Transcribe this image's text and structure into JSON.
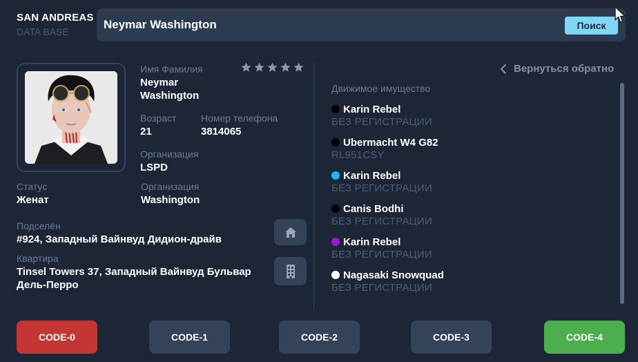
{
  "brand": {
    "title": "SAN ANDREAS",
    "subtitle": "DATA BASE"
  },
  "search": {
    "value": "Neymar Washington",
    "button_label": "Поиск"
  },
  "profile": {
    "name_label": "Имя Фамилия",
    "name_line1": "Neymar",
    "name_line2": "Washington",
    "rating": {
      "value": 0,
      "max": 5
    },
    "age_label": "Возраст",
    "age_value": "21",
    "phone_label": "Номер телефона",
    "phone_value": "3814065",
    "org_label": "Организация",
    "org_value": "LSPD",
    "status_label": "Статус",
    "status_value": "Женат",
    "org2_label": "Организация",
    "org2_value": "Washington",
    "settled_label": "Подселён",
    "settled_value": "#924, Западный Вайнвуд Дидион-драйв",
    "apartment_label": "Квартира",
    "apartment_line1": "Tinsel Towers 37, Западный Вайнвуд Бульвар",
    "apartment_line2": "Дель-Перро"
  },
  "icons": {
    "home": "home-icon",
    "building": "building-icon",
    "star": "star-icon",
    "back": "chevron-left-icon",
    "cursor": "mouse-cursor-icon"
  },
  "vehicles": {
    "header": "Движимое имущество",
    "back_label": "Вернуться обратно",
    "items": [
      {
        "name": "Karin Rebel",
        "plate": "БЕЗ РЕГИСТРАЦИИ",
        "color": "#000000"
      },
      {
        "name": "Ubermacht W4 G82",
        "plate": "RL951CSY",
        "color": "#000000"
      },
      {
        "name": "Karin Rebel",
        "plate": "БЕЗ РЕГИСТРАЦИИ",
        "color": "#1ab8f0"
      },
      {
        "name": "Canis Bodhi",
        "plate": "БЕЗ РЕГИСТРАЦИИ",
        "color": "#000000"
      },
      {
        "name": "Karin Rebel",
        "plate": "БЕЗ РЕГИСТРАЦИИ",
        "color": "#9b19d6"
      },
      {
        "name": "Nagasaki Snowquad",
        "plate": "БЕЗ РЕГИСТРАЦИИ",
        "color": "#ffffff"
      }
    ]
  },
  "codes": [
    {
      "label": "CODE-0",
      "color": "#c33634"
    },
    {
      "label": "CODE-1",
      "color": "#34435a"
    },
    {
      "label": "CODE-2",
      "color": "#34435a"
    },
    {
      "label": "CODE-3",
      "color": "#34435a"
    },
    {
      "label": "CODE-4",
      "color": "#4cae4f"
    }
  ],
  "colors": {
    "background": "#1c2637",
    "panel": "#2d3b50",
    "accent": "#7fd6f5",
    "muted_text": "#6f7c8f"
  }
}
